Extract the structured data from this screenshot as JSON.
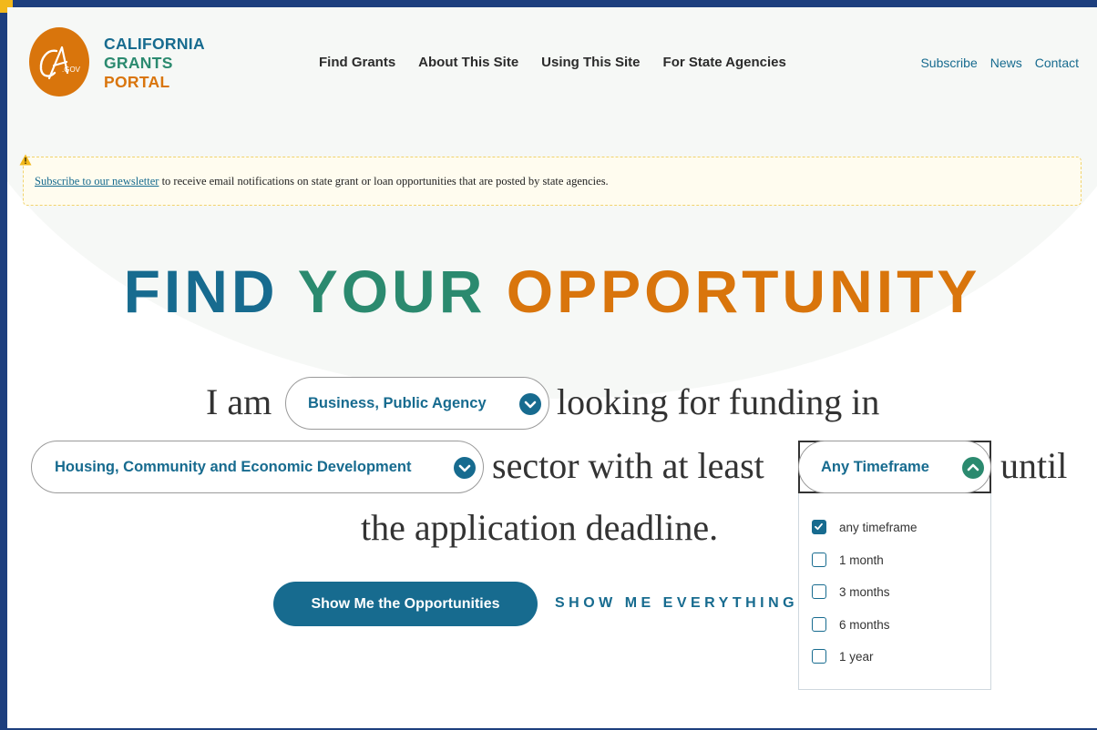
{
  "logo": {
    "badge_text": "CA.GOV",
    "line1": "CALIFORNIA",
    "line2": "GRANTS",
    "line3": "PORTAL"
  },
  "main_nav": [
    "Find Grants",
    "About This Site",
    "Using This Site",
    "For State Agencies"
  ],
  "utility_nav": [
    "Subscribe",
    "News",
    "Contact"
  ],
  "notice": {
    "link_text": "Subscribe to our newsletter",
    "text": " to receive email notifications on state grant or loan opportunities that are posted by state agencies."
  },
  "hero": {
    "title_part1": "FIND",
    "title_part2": "YOUR",
    "title_part3": "OPPORTUNITY"
  },
  "search_sentence": {
    "part1": "I am",
    "part2": "looking for funding in",
    "part3": "sector with at least",
    "part4": "until",
    "part5": "the application deadline."
  },
  "applicant_select": {
    "value": "Business, Public Agency"
  },
  "sector_select": {
    "value": "Housing, Community and Economic Development"
  },
  "timeframe_select": {
    "value": "Any Timeframe",
    "options": [
      {
        "label": "any timeframe",
        "checked": true
      },
      {
        "label": "1 month",
        "checked": false
      },
      {
        "label": "3 months",
        "checked": false
      },
      {
        "label": "6 months",
        "checked": false
      },
      {
        "label": "1 year",
        "checked": false
      }
    ]
  },
  "actions": {
    "primary_label": "Show Me the Opportunities",
    "secondary_label": "SHOW ME EVERYTHING"
  },
  "colors": {
    "brand_blue": "#176b8f",
    "brand_teal": "#2b8a6f",
    "brand_orange": "#d9750c",
    "frame_navy": "#1d3f7e",
    "accent_gold": "#f2b81b"
  },
  "icons": [
    "warning-icon",
    "chevron-down-icon",
    "chevron-up-icon",
    "checkmark-icon"
  ]
}
